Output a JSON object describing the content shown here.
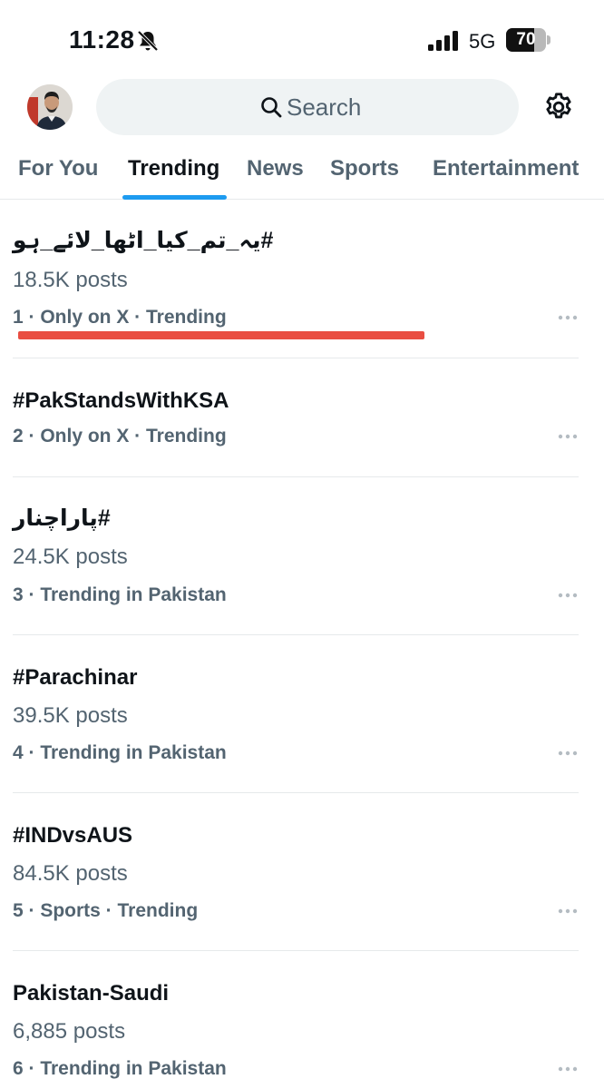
{
  "status_bar": {
    "time": "11:28",
    "network": "5G",
    "battery": "70",
    "battery_level": 0.7
  },
  "header": {
    "search_placeholder": "Search",
    "icons": [
      "avatar",
      "search-icon",
      "gear-icon"
    ]
  },
  "tabs": [
    {
      "label": "For You"
    },
    {
      "label": "Trending"
    },
    {
      "label": "News"
    },
    {
      "label": "Sports"
    },
    {
      "label": "Entertainment"
    }
  ],
  "active_tab": "Trending",
  "trends": [
    {
      "title": "#یہ_تم_کیا_اٹھا_لائے_ہو",
      "posts": "18.5K posts",
      "meta": "1 · Only on X · Trending"
    },
    {
      "title": "#PakStandsWithKSA",
      "posts": "",
      "meta": "2 · Only on X · Trending"
    },
    {
      "title": "#پاراچنار",
      "posts": "24.5K posts",
      "meta": "3 · Trending in Pakistan"
    },
    {
      "title": "#Parachinar",
      "posts": "39.5K posts",
      "meta": "4 · Trending in Pakistan"
    },
    {
      "title": "#INDvsAUS",
      "posts": "84.5K posts",
      "meta": "5 · Sports · Trending"
    },
    {
      "title": "Pakistan-Saudi",
      "posts": "6,885 posts",
      "meta": "6 · Trending in Pakistan"
    }
  ],
  "colors": {
    "accent": "#1d9bf0",
    "text_primary": "#0f1419",
    "text_secondary": "#536471",
    "search_bg": "#eff3f4",
    "annotation": "#e94e42"
  }
}
